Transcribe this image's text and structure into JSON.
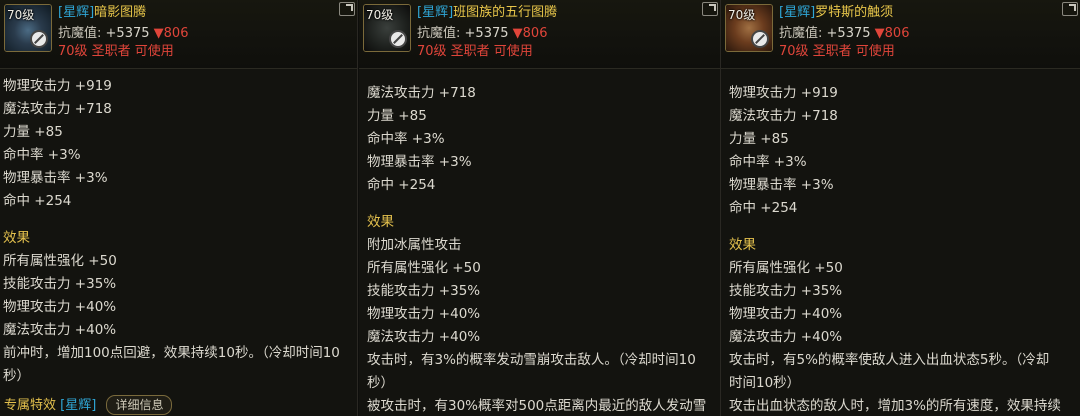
{
  "panels": [
    {
      "level": "70级",
      "rarity": "[星辉]",
      "name": "暗影图腾",
      "res_label": "抗魔值:",
      "res_value": "+5375",
      "res_down": "▼806",
      "requirement": "70级 圣职者 可使用",
      "stats": [
        "物理攻击力 +919",
        "魔法攻击力 +718",
        "力量 +85",
        "命中率 +3%",
        "物理暴击率 +3%",
        "命中 +254"
      ],
      "effect_title": "效果",
      "effects": [
        "所有属性强化 +50",
        "技能攻击力 +35%",
        "物理攻击力 +40%",
        "魔法攻击力 +40%",
        "前冲时，增加100点回避，效果持续10秒。（冷却时间10",
        "秒）"
      ],
      "special_title": "专属特效",
      "special_rarity": "[星辉]",
      "detail_button": "详细信息"
    },
    {
      "level": "70级",
      "rarity": "[星辉]",
      "name": "班图族的五行图腾",
      "res_label": "抗魔值:",
      "res_value": "+5375",
      "res_down": "▼806",
      "requirement": "70级 圣职者 可使用",
      "stats": [
        "魔法攻击力 +718",
        "力量 +85",
        "命中率 +3%",
        "物理暴击率 +3%",
        "命中 +254"
      ],
      "effect_title": "效果",
      "effects": [
        "附加冰属性攻击",
        "所有属性强化 +50",
        "技能攻击力 +35%",
        "物理攻击力 +40%",
        "魔法攻击力 +40%",
        "攻击时，有3%的概率发动雪崩攻击敌人。（冷却时间10",
        "秒）",
        "被攻击时，有30%概率对500点距离内最近的敌人发动雪"
      ]
    },
    {
      "level": "70级",
      "rarity": "[星辉]",
      "name": "罗特斯的触须",
      "res_label": "抗魔值:",
      "res_value": "+5375",
      "res_down": "▼806",
      "requirement": "70级 圣职者 可使用",
      "stats": [
        "物理攻击力 +919",
        "魔法攻击力 +718",
        "力量 +85",
        "命中率 +3%",
        "物理暴击率 +3%",
        "命中 +254"
      ],
      "effect_title": "效果",
      "effects": [
        "所有属性强化 +50",
        "技能攻击力 +35%",
        "物理攻击力 +40%",
        "魔法攻击力 +40%",
        "攻击时，有5%的概率使敌人进入出血状态5秒。（冷却",
        "时间10秒）",
        "攻击出血状态的敌人时，增加3%的所有速度，效果持续"
      ]
    }
  ]
}
